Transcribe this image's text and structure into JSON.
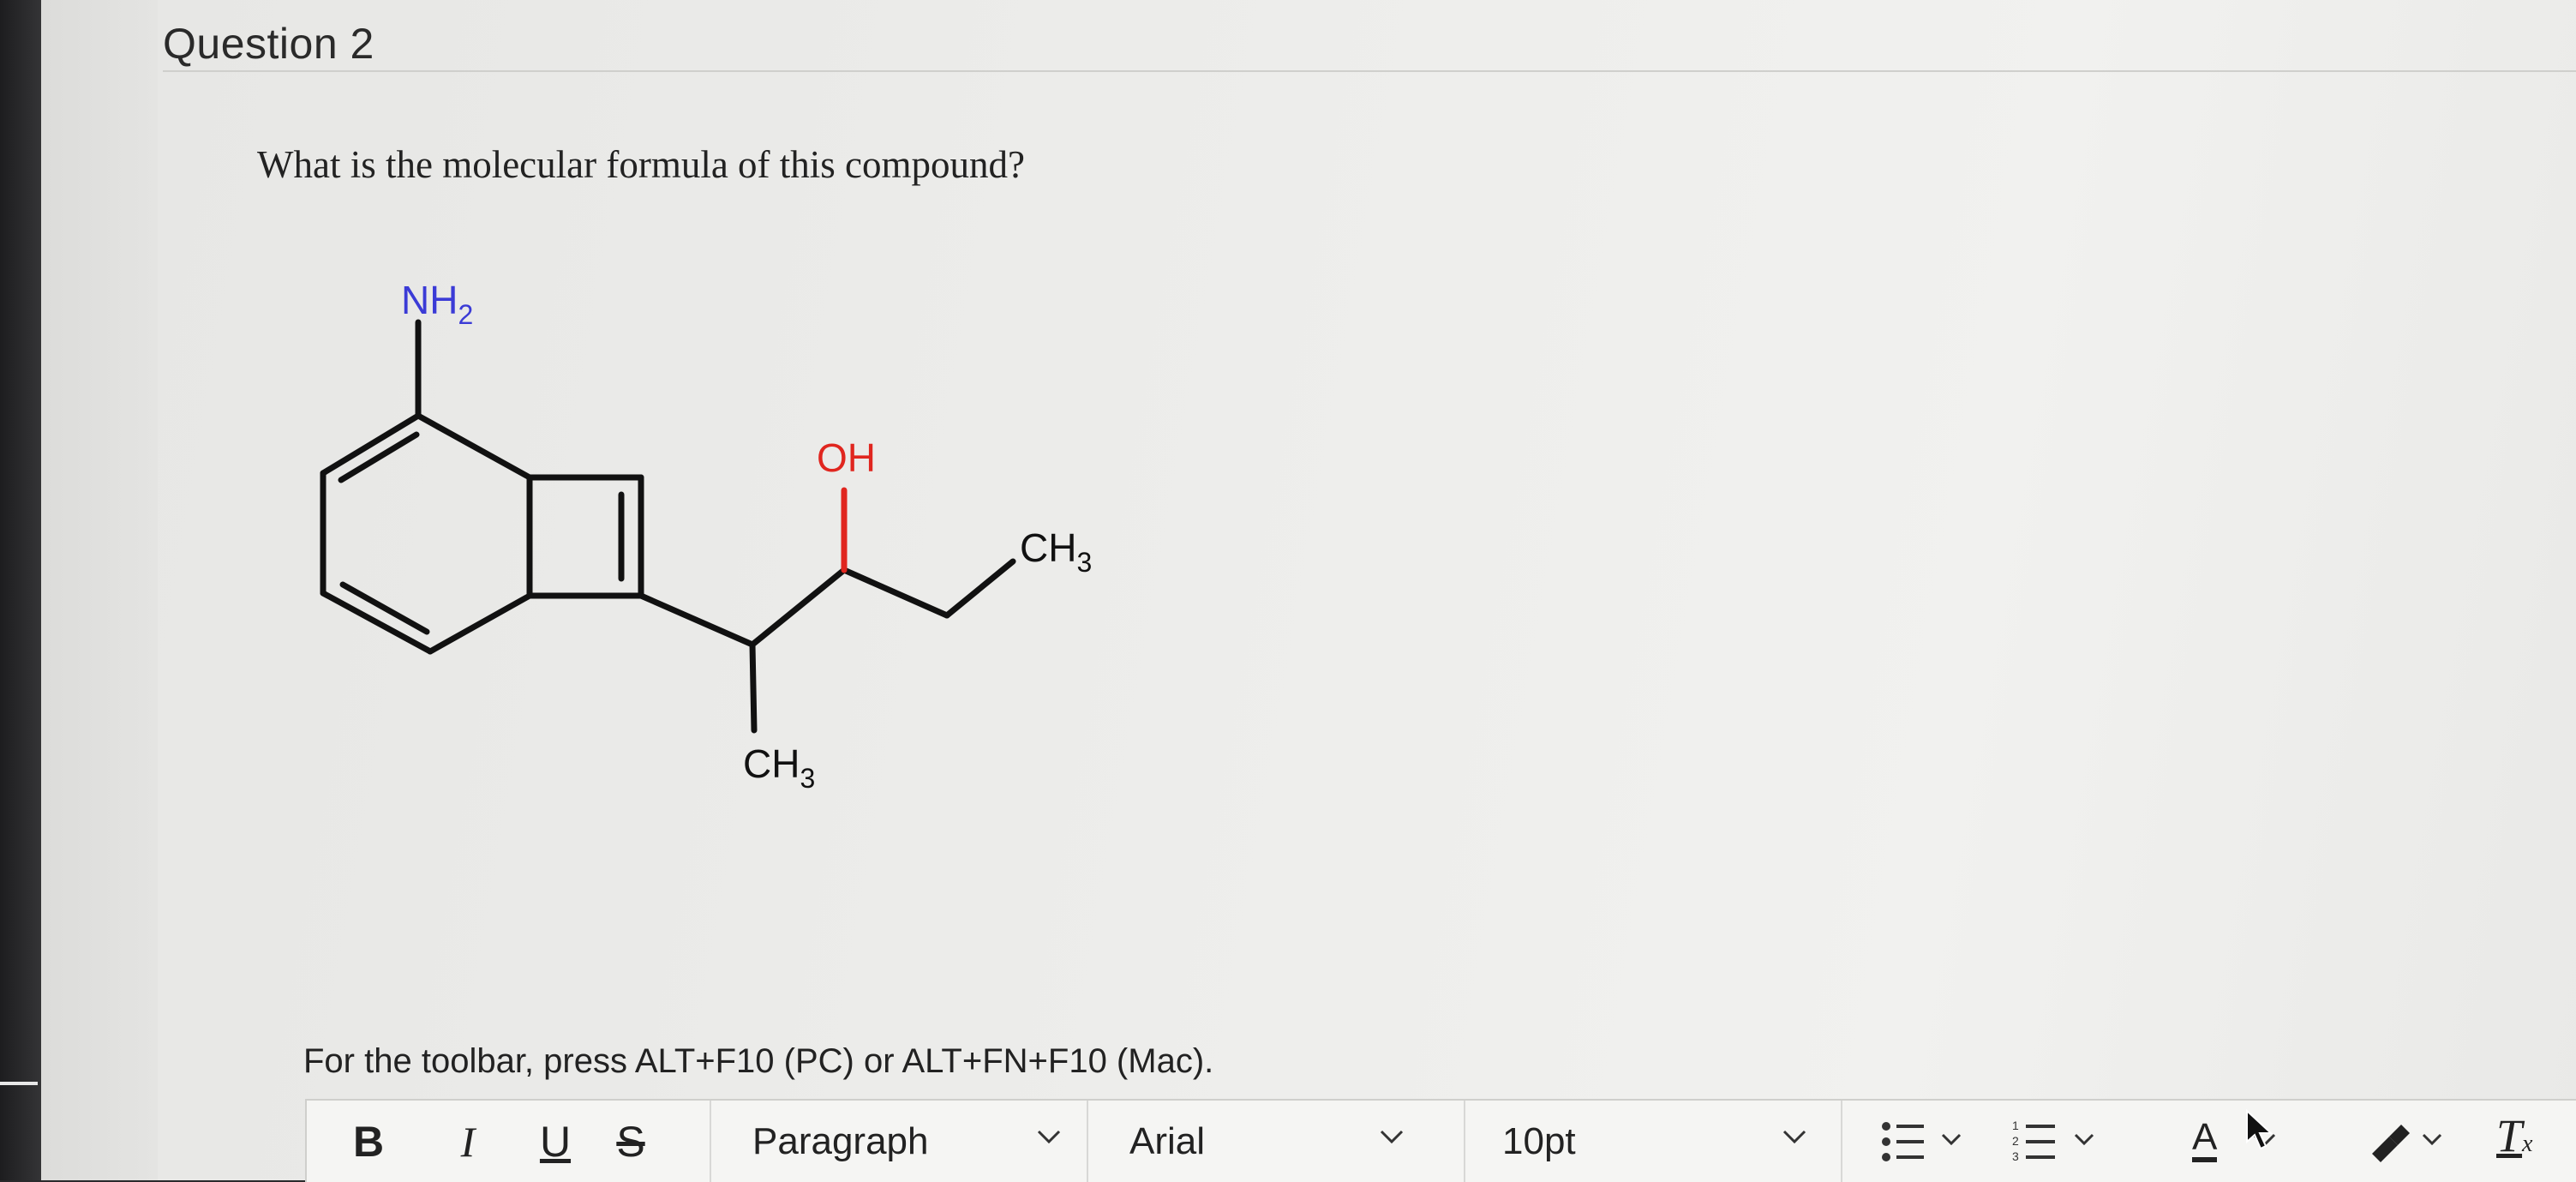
{
  "page": {
    "header": "Question 2",
    "question": "What is the molecular formula of this compound?"
  },
  "molecule": {
    "labels": {
      "nh2": "NH",
      "nh2_sub": "2",
      "oh": "OH",
      "ch3_a": "CH",
      "ch3_a_sub": "3",
      "ch3_b": "CH",
      "ch3_b_sub": "3"
    },
    "colors": {
      "nitrogen": "#3b3bd6",
      "oxygen": "#e0261f",
      "bond": "#111111"
    }
  },
  "editor": {
    "toolbar_hint": "For the toolbar, press ALT+F10 (PC) or ALT+FN+F10 (Mac).",
    "bold": "B",
    "italic": "I",
    "underline": "U",
    "strike": "S",
    "paragraph": "Paragraph",
    "font": "Arial",
    "size": "10pt",
    "text_color_label": "A",
    "clear_format": "T",
    "clear_format_sub": "x",
    "icons": [
      "bold-icon",
      "italic-icon",
      "underline-icon",
      "strikethrough-icon",
      "bullet-list-icon",
      "numbered-list-icon",
      "text-color-icon",
      "highlight-icon",
      "clear-formatting-icon"
    ]
  }
}
